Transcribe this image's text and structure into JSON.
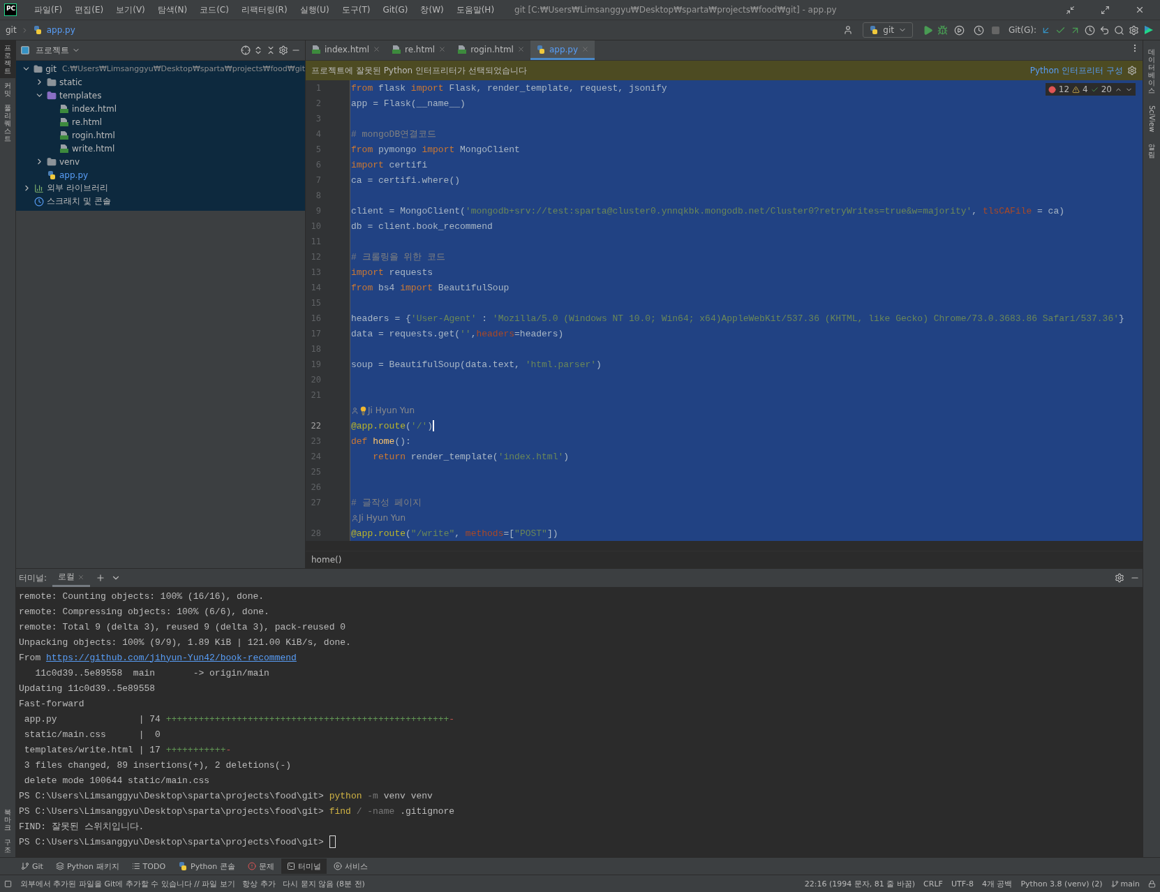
{
  "window": {
    "app_icon": "PC",
    "title": "git [C:₩Users₩Limsanggyu₩Desktop₩sparta₩projects₩food₩git] - app.py"
  },
  "menu": [
    "파일(F)",
    "편집(E)",
    "보기(V)",
    "탐색(N)",
    "코드(C)",
    "리팩터링(R)",
    "실행(U)",
    "도구(T)",
    "Git(G)",
    "창(W)",
    "도움말(H)"
  ],
  "nav": {
    "crumbs": [
      "git",
      "app.py"
    ],
    "run_config": "git",
    "vcs_label": "Git(G):"
  },
  "left_strip": [
    {
      "label": "프로젝트",
      "selected": true
    },
    {
      "label": "커밋",
      "selected": false
    },
    {
      "label": "풀 리퀘스트",
      "selected": false
    }
  ],
  "left_strip_bottom": [
    {
      "label": "북마크"
    },
    {
      "label": "구조"
    }
  ],
  "project": {
    "title": "프로젝트",
    "tree": [
      {
        "label": "git",
        "kind": "root",
        "path": "C:₩Users₩Limsanggyu₩Desktop₩sparta₩projects₩food₩git",
        "expanded": true,
        "modified": false,
        "children": [
          {
            "label": "static",
            "kind": "folder",
            "expanded": false,
            "modified": false
          },
          {
            "label": "templates",
            "kind": "template-folder",
            "expanded": true,
            "modified": false,
            "children": [
              {
                "label": "index.html",
                "kind": "html",
                "modified": false
              },
              {
                "label": "re.html",
                "kind": "html",
                "modified": false
              },
              {
                "label": "rogin.html",
                "kind": "html",
                "modified": false
              },
              {
                "label": "write.html",
                "kind": "html",
                "modified": false
              }
            ]
          },
          {
            "label": "venv",
            "kind": "folder",
            "expanded": false,
            "modified": false
          },
          {
            "label": "app.py",
            "kind": "python",
            "modified": true
          }
        ]
      },
      {
        "label": "외부 라이브러리",
        "kind": "library",
        "expanded": false,
        "modified": false
      },
      {
        "label": "스크래치 및 콘솔",
        "kind": "scratch",
        "modified": false
      }
    ]
  },
  "editor": {
    "tabs": [
      {
        "label": "index.html",
        "kind": "html",
        "selected": false
      },
      {
        "label": "re.html",
        "kind": "html",
        "selected": false
      },
      {
        "label": "rogin.html",
        "kind": "html",
        "selected": false
      },
      {
        "label": "app.py",
        "kind": "python",
        "selected": true
      }
    ],
    "banner": {
      "text": "프로젝트에 잘못된 Python 인터프리터가 선택되었습니다",
      "action": "Python 인터프리터 구성"
    },
    "inspections": {
      "errors": "12",
      "warnings": "4",
      "ok": "20"
    },
    "lines": [
      {
        "kind": "code",
        "number": "1",
        "current": false,
        "segments": [
          {
            "kind": "keyword",
            "text": "from"
          },
          {
            "kind": "plain",
            "text": " flask "
          },
          {
            "kind": "keyword",
            "text": "import"
          },
          {
            "kind": "plain",
            "text": " Flask, render_template, request, jsonify"
          }
        ]
      },
      {
        "kind": "code",
        "number": "2",
        "current": false,
        "segments": [
          {
            "kind": "plain",
            "text": "app = Flask(__name__)"
          }
        ]
      },
      {
        "kind": "code",
        "number": "3",
        "current": false
      },
      {
        "kind": "code",
        "number": "4",
        "current": false,
        "segments": [
          {
            "kind": "comment",
            "text": "# mongoDB연결코드"
          }
        ]
      },
      {
        "kind": "code",
        "number": "5",
        "current": false,
        "segments": [
          {
            "kind": "keyword",
            "text": "from"
          },
          {
            "kind": "plain",
            "text": " pymongo "
          },
          {
            "kind": "keyword",
            "text": "import"
          },
          {
            "kind": "plain",
            "text": " MongoClient"
          }
        ]
      },
      {
        "kind": "code",
        "number": "6",
        "current": false,
        "segments": [
          {
            "kind": "keyword",
            "text": "import"
          },
          {
            "kind": "plain",
            "text": " certifi"
          }
        ]
      },
      {
        "kind": "code",
        "number": "7",
        "current": false,
        "segments": [
          {
            "kind": "plain",
            "text": "ca = certifi.where()"
          }
        ]
      },
      {
        "kind": "code",
        "number": "8",
        "current": false
      },
      {
        "kind": "code",
        "number": "9",
        "current": false,
        "segments": [
          {
            "kind": "plain",
            "text": "client = MongoClient("
          },
          {
            "kind": "string",
            "text": "'mongodb+srv://test:sparta@cluster0.ynnqkbk.mongodb.net/Cluster0?retryWrites=true&w=majority'"
          },
          {
            "kind": "plain",
            "text": ", "
          },
          {
            "kind": "param",
            "text": "tlsCAFile"
          },
          {
            "kind": "plain",
            "text": " = ca)"
          }
        ]
      },
      {
        "kind": "code",
        "number": "10",
        "current": false,
        "segments": [
          {
            "kind": "plain",
            "text": "db = client.book_recommend"
          }
        ]
      },
      {
        "kind": "code",
        "number": "11",
        "current": false
      },
      {
        "kind": "code",
        "number": "12",
        "current": false,
        "segments": [
          {
            "kind": "comment",
            "text": "# 크롤링을 위한 코드"
          }
        ]
      },
      {
        "kind": "code",
        "number": "13",
        "current": false,
        "segments": [
          {
            "kind": "keyword",
            "text": "import"
          },
          {
            "kind": "plain",
            "text": " requests"
          }
        ]
      },
      {
        "kind": "code",
        "number": "14",
        "current": false,
        "segments": [
          {
            "kind": "keyword",
            "text": "from"
          },
          {
            "kind": "plain",
            "text": " bs4 "
          },
          {
            "kind": "keyword",
            "text": "import"
          },
          {
            "kind": "plain",
            "text": " BeautifulSoup"
          }
        ]
      },
      {
        "kind": "code",
        "number": "15",
        "current": false
      },
      {
        "kind": "code",
        "number": "16",
        "current": false,
        "segments": [
          {
            "kind": "plain",
            "text": "headers = {"
          },
          {
            "kind": "string",
            "text": "'User-Agent'"
          },
          {
            "kind": "plain",
            "text": " : "
          },
          {
            "kind": "string",
            "text": "'Mozilla/5.0 (Windows NT 10.0; Win64; x64)AppleWebKit/537.36 (KHTML, like Gecko) Chrome/73.0.3683.86 Safari/537.36'"
          },
          {
            "kind": "plain",
            "text": "}"
          }
        ]
      },
      {
        "kind": "code",
        "number": "17",
        "current": false,
        "segments": [
          {
            "kind": "plain",
            "text": "data = requests.get("
          },
          {
            "kind": "string",
            "text": "''"
          },
          {
            "kind": "plain",
            "text": ","
          },
          {
            "kind": "param",
            "text": "headers"
          },
          {
            "kind": "plain",
            "text": "=headers)"
          }
        ]
      },
      {
        "kind": "code",
        "number": "18",
        "current": false
      },
      {
        "kind": "code",
        "number": "19",
        "current": false,
        "segments": [
          {
            "kind": "plain",
            "text": "soup = BeautifulSoup(data.text, "
          },
          {
            "kind": "string",
            "text": "'html.parser'"
          },
          {
            "kind": "plain",
            "text": ")"
          }
        ]
      },
      {
        "kind": "code",
        "number": "20",
        "current": false
      },
      {
        "kind": "code",
        "number": "21",
        "current": false
      },
      {
        "kind": "author",
        "text": "Ji Hyun Yun",
        "bulb": true
      },
      {
        "kind": "code",
        "number": "22",
        "current": true,
        "segments": [
          {
            "kind": "decorator",
            "text": "@app.route"
          },
          {
            "kind": "plain",
            "text": "("
          },
          {
            "kind": "string",
            "text": "'/'"
          },
          {
            "kind": "plain",
            "text": ")"
          }
        ]
      },
      {
        "kind": "code",
        "number": "23",
        "current": false,
        "segments": [
          {
            "kind": "keyword",
            "text": "def"
          },
          {
            "kind": "function",
            "text": " home"
          },
          {
            "kind": "plain",
            "text": "():"
          }
        ]
      },
      {
        "kind": "code",
        "number": "24",
        "current": false,
        "segments": [
          {
            "kind": "keyword",
            "text": "    return"
          },
          {
            "kind": "plain",
            "text": " render_template("
          },
          {
            "kind": "string",
            "text": "'index.html'"
          },
          {
            "kind": "plain",
            "text": ")"
          }
        ]
      },
      {
        "kind": "code",
        "number": "25",
        "current": false
      },
      {
        "kind": "code",
        "number": "26",
        "current": false
      },
      {
        "kind": "code",
        "number": "27",
        "current": false,
        "segments": [
          {
            "kind": "comment",
            "text": "# 글작성 페이지"
          }
        ]
      },
      {
        "kind": "author",
        "text": "Ji Hyun Yun",
        "bulb": false
      },
      {
        "kind": "code",
        "number": "28",
        "current": false,
        "segments": [
          {
            "kind": "decorator",
            "text": "@app.route"
          },
          {
            "kind": "plain",
            "text": "("
          },
          {
            "kind": "string",
            "text": "\"/write\""
          },
          {
            "kind": "plain",
            "text": ", "
          },
          {
            "kind": "param",
            "text": "methods"
          },
          {
            "kind": "plain",
            "text": "=["
          },
          {
            "kind": "string",
            "text": "\"POST\""
          },
          {
            "kind": "plain",
            "text": "])"
          }
        ]
      }
    ],
    "breadcrumb": "home()"
  },
  "terminal": {
    "title": "터미널:",
    "tabs": [
      {
        "label": "로컬",
        "selected": true
      }
    ],
    "lines": [
      {
        "cursor": false,
        "segments": [
          {
            "kind": "plain",
            "text": "remote: Counting objects: 100% (16/16), done."
          }
        ]
      },
      {
        "cursor": false,
        "segments": [
          {
            "kind": "plain",
            "text": "remote: Compressing objects: 100% (6/6), done."
          }
        ]
      },
      {
        "cursor": false,
        "segments": [
          {
            "kind": "plain",
            "text": "remote: Total 9 (delta 3), reused 9 (delta 3), pack-reused 0"
          }
        ]
      },
      {
        "cursor": false,
        "segments": [
          {
            "kind": "plain",
            "text": "Unpacking objects: 100% (9/9), 1.89 KiB | 121.00 KiB/s, done."
          }
        ]
      },
      {
        "cursor": false,
        "segments": [
          {
            "kind": "plain",
            "text": "From "
          },
          {
            "kind": "link",
            "text": "https://github.com/jihyun-Yun42/book-recommend"
          }
        ]
      },
      {
        "cursor": false,
        "segments": [
          {
            "kind": "plain",
            "text": "   11c0d39..5e89558  main       -> origin/main"
          }
        ]
      },
      {
        "cursor": false,
        "segments": [
          {
            "kind": "plain",
            "text": "Updating 11c0d39..5e89558"
          }
        ]
      },
      {
        "cursor": false,
        "segments": [
          {
            "kind": "plain",
            "text": "Fast-forward"
          }
        ]
      },
      {
        "cursor": false,
        "segments": [
          {
            "kind": "plain",
            "text": " app.py               | 74 "
          },
          {
            "kind": "plus",
            "text": "++++++++++++++++++++++++++++++++++++++++++++++++++++"
          },
          {
            "kind": "minus",
            "text": "-"
          }
        ]
      },
      {
        "cursor": false,
        "segments": [
          {
            "kind": "plain",
            "text": " static/main.css      |  0"
          }
        ]
      },
      {
        "cursor": false,
        "segments": [
          {
            "kind": "plain",
            "text": " templates/write.html | 17 "
          },
          {
            "kind": "plus",
            "text": "+++++++++++"
          },
          {
            "kind": "minus",
            "text": "-"
          }
        ]
      },
      {
        "cursor": false,
        "segments": [
          {
            "kind": "plain",
            "text": " 3 files changed, 89 insertions(+), 2 deletions(-)"
          }
        ]
      },
      {
        "cursor": false,
        "segments": [
          {
            "kind": "plain",
            "text": " delete mode 100644 static/main.css"
          }
        ]
      },
      {
        "cursor": false,
        "segments": [
          {
            "kind": "plain",
            "text": "PS C:\\Users\\Limsanggyu\\Desktop\\sparta\\projects\\food\\git> "
          },
          {
            "kind": "command",
            "text": "python"
          },
          {
            "kind": "flag",
            "text": " -m"
          },
          {
            "kind": "plain",
            "text": " venv venv"
          }
        ]
      },
      {
        "cursor": false,
        "segments": [
          {
            "kind": "plain",
            "text": "PS C:\\Users\\Limsanggyu\\Desktop\\sparta\\projects\\food\\git> "
          },
          {
            "kind": "command",
            "text": "find"
          },
          {
            "kind": "flag",
            "text": " /"
          },
          {
            "kind": "flag",
            "text": " -name"
          },
          {
            "kind": "plain",
            "text": " .gitignore"
          }
        ]
      },
      {
        "cursor": false,
        "segments": [
          {
            "kind": "plain",
            "text": "FIND: 잘못된 스위치입니다."
          }
        ]
      },
      {
        "cursor": true,
        "segments": [
          {
            "kind": "plain",
            "text": "PS C:\\Users\\Limsanggyu\\Desktop\\sparta\\projects\\food\\git> "
          }
        ]
      }
    ]
  },
  "right_strip": [
    {
      "label": "데이터베이스",
      "kind": "korean"
    },
    {
      "label": "SciView",
      "kind": "latin"
    },
    {
      "label": "알림",
      "kind": "korean"
    }
  ],
  "tool_tabs": [
    {
      "label": "Git",
      "kind": "git",
      "selected": false
    },
    {
      "label": "Python 패키지",
      "kind": "packages",
      "selected": false
    },
    {
      "label": "TODO",
      "kind": "todo",
      "selected": false
    },
    {
      "label": "Python 콘솔",
      "kind": "console",
      "selected": false
    },
    {
      "label": "문제",
      "kind": "problems",
      "selected": false
    },
    {
      "label": "터미널",
      "kind": "terminal",
      "selected": true
    },
    {
      "label": "서비스",
      "kind": "services",
      "selected": false
    }
  ],
  "status": {
    "message": "외부에서 추가된 파일을 Git에 추가할 수 있습니다 // 파일 보기   항상 추가   다시 묻지 않음 (8분 전)",
    "items": [
      "22:16 (1994 문자, 81 줄 바꿈)",
      "CRLF",
      "UTF-8",
      "4개 공백",
      "Python 3.8 (venv) (2)"
    ],
    "branch": "main"
  }
}
